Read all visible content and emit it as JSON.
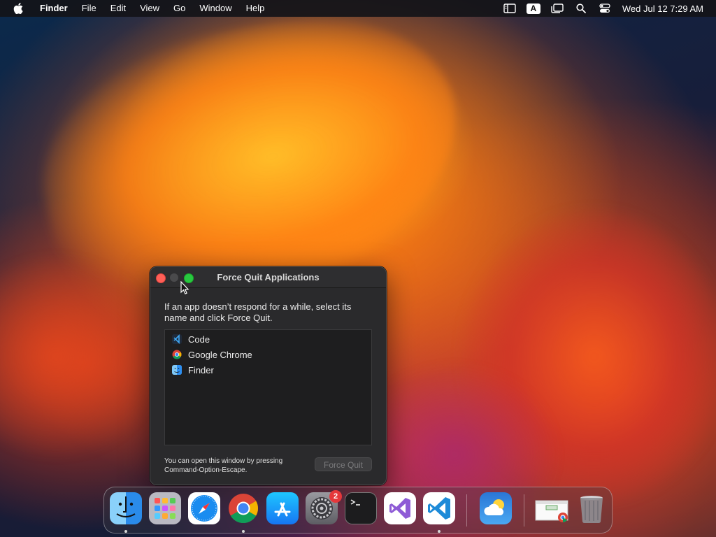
{
  "menubar": {
    "apple_icon": "apple-logo-icon",
    "app_name": "Finder",
    "items": [
      "File",
      "Edit",
      "View",
      "Go",
      "Window",
      "Help"
    ],
    "status_icons": [
      "sidebar-icon",
      "input-source-icon",
      "window-switch-icon",
      "spotlight-search-icon",
      "control-center-icon"
    ],
    "input_source_label": "A",
    "clock": "Wed Jul 12  7:29 AM"
  },
  "force_quit": {
    "title": "Force Quit Applications",
    "description": "If an app doesn’t respond for a while, select its name and click Force Quit.",
    "apps": [
      {
        "name": "Code",
        "icon": "vscode-icon"
      },
      {
        "name": "Google Chrome",
        "icon": "chrome-icon"
      },
      {
        "name": "Finder",
        "icon": "finder-icon"
      }
    ],
    "hint": "You can open this window by pressing Command-Option-Escape.",
    "button_label": "Force Quit"
  },
  "dock": {
    "items": [
      {
        "name": "Finder",
        "icon": "finder-icon",
        "running": true
      },
      {
        "name": "Launchpad",
        "icon": "launchpad-icon",
        "running": false
      },
      {
        "name": "Safari",
        "icon": "safari-icon",
        "running": false
      },
      {
        "name": "Google Chrome",
        "icon": "chrome-icon",
        "running": true
      },
      {
        "name": "App Store",
        "icon": "app-store-icon",
        "running": false
      },
      {
        "name": "System Settings",
        "icon": "system-settings-icon",
        "running": false,
        "badge": "2"
      },
      {
        "name": "Terminal",
        "icon": "terminal-icon",
        "running": false
      },
      {
        "name": "Visual Studio",
        "icon": "visual-studio-icon",
        "running": false
      },
      {
        "name": "Visual Studio Code",
        "icon": "vscode-icon",
        "running": true
      },
      {
        "name": "Weather",
        "icon": "weather-icon",
        "running": false
      },
      {
        "name": "Chrome Window",
        "icon": "chrome-window-thumbnail-icon",
        "running": false
      },
      {
        "name": "Trash",
        "icon": "trash-icon",
        "running": false
      }
    ]
  },
  "colors": {
    "close": "#ff5f57",
    "maximize": "#28c840",
    "badge": "#e5383b"
  }
}
